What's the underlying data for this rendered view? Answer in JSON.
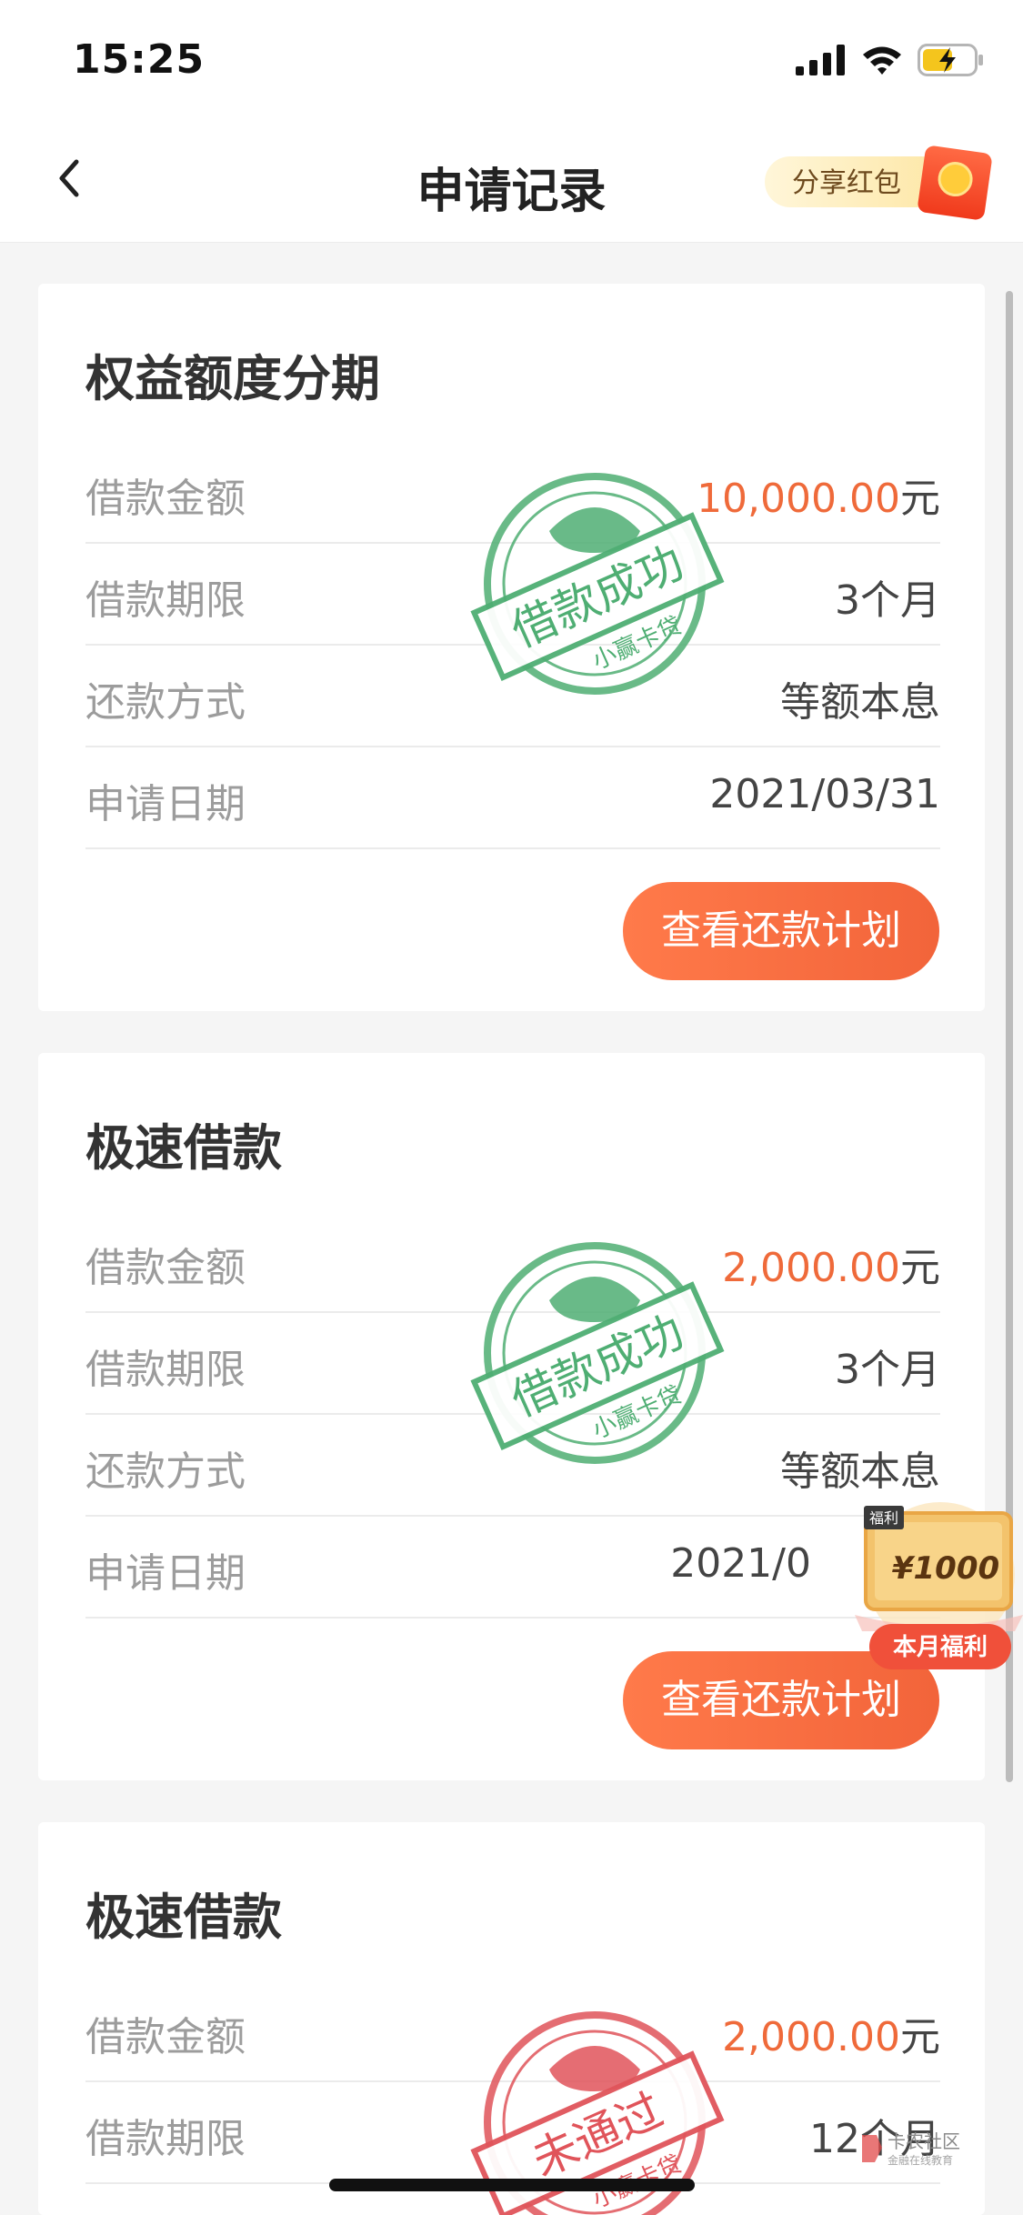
{
  "status_bar": {
    "time": "15:25"
  },
  "nav": {
    "title": "申请记录",
    "share_label": "分享红包"
  },
  "cards": [
    {
      "title": "权益额度分期",
      "rows": [
        {
          "label": "借款金额",
          "amount": "10,000.00",
          "unit": "元"
        },
        {
          "label": "借款期限",
          "value": "3个月"
        },
        {
          "label": "还款方式",
          "value": "等额本息"
        },
        {
          "label": "申请日期",
          "value": "2021/03/31"
        }
      ],
      "button": "查看还款计划",
      "stamp": {
        "text": "借款成功",
        "sub": "小赢卡贷",
        "color": "#4fae73"
      }
    },
    {
      "title": "极速借款",
      "rows": [
        {
          "label": "借款金额",
          "amount": "2,000.00",
          "unit": "元"
        },
        {
          "label": "借款期限",
          "value": "3个月"
        },
        {
          "label": "还款方式",
          "value": "等额本息"
        },
        {
          "label": "申请日期",
          "value": "2021/0"
        }
      ],
      "button": "查看还款计划",
      "stamp": {
        "text": "借款成功",
        "sub": "小赢卡贷",
        "color": "#4fae73"
      }
    },
    {
      "title": "极速借款",
      "rows": [
        {
          "label": "借款金额",
          "amount": "2,000.00",
          "unit": "元"
        },
        {
          "label": "借款期限",
          "value": "12个月"
        }
      ],
      "stamp": {
        "text": "未通过",
        "sub": "小赢卡贷",
        "color": "#e0545a"
      }
    }
  ],
  "promo": {
    "tag": "福利",
    "amount": "¥1000",
    "label": "本月福利"
  },
  "watermark": {
    "title": "卡农社区",
    "sub": "金融在线教育"
  },
  "colors": {
    "accent": "#f2643a",
    "amount": "#ef6a3a",
    "success_stamp": "#4fae73",
    "fail_stamp": "#e0545a"
  }
}
